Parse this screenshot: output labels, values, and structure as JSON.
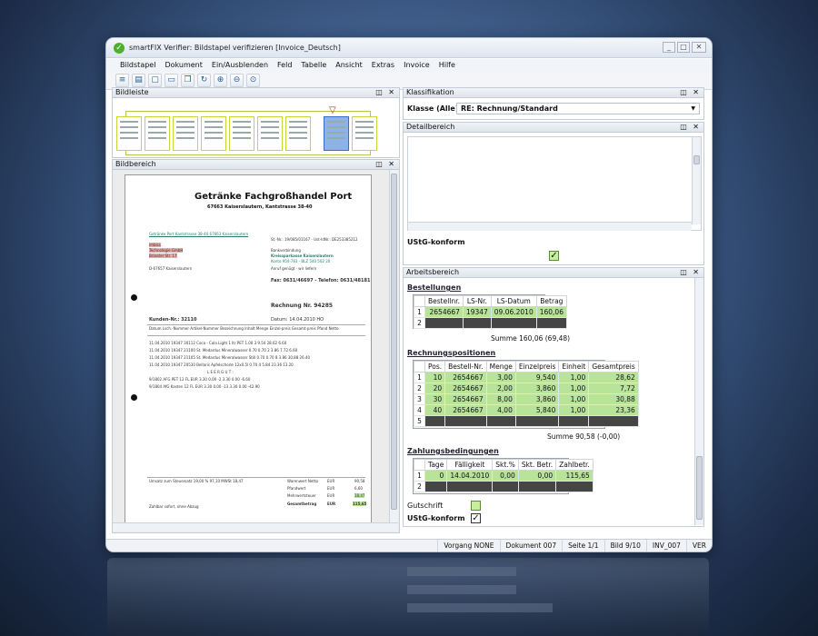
{
  "window": {
    "title": "smartFIX Verifier: Bildstapel verifizieren [Invoice_Deutsch]",
    "buttons": [
      "_",
      "□",
      "✕"
    ]
  },
  "menu": [
    "Bildstapel",
    "Dokument",
    "Ein/Ausblenden",
    "Feld",
    "Tabelle",
    "Ansicht",
    "Extras",
    "Invoice",
    "Hilfe"
  ],
  "panels": {
    "bildleiste": "Bildleiste",
    "bildbereich": "Bildbereich",
    "klassifikation": "Klassifikation",
    "detailbereich": "Detailbereich",
    "arbeitsbereich": "Arbeitsbereich"
  },
  "klassifikation": {
    "label": "Klasse (Alle):",
    "value": "RE: Rechnung/Standard"
  },
  "detail": {
    "ustg_label": "UStG-konform"
  },
  "document": {
    "title": "Getränke Fachgroßhandel Port",
    "address": "67663 Kaiserslautern, Kantstrasse 38-40",
    "sender_line": "Getränke Port  Kantstrasse 38-40  67663 Kaiserslautern",
    "recipient1": "imbiss",
    "recipient2": "Technologie GmbH",
    "recipient3": "Brassler Str. 17",
    "recipient4": "D-67657 Kaiserslautern",
    "steuer": "St.-Nr.: 19/085/01167 - Ust-IdNr.: DE253385212",
    "bank1": "Bankverbindung",
    "bank2": "Kreissparkasse Kaiserslautern",
    "bank3": "Konto 954-783 - BLZ 540 502 20",
    "anruf": "Anruf genügt - wir liefern",
    "fax": "Fax: 0631/46697  -  Telefon: 0631/48181",
    "rechnung": "Rechnung Nr. 94285",
    "kunden": "Kunden-Nr.: 32110",
    "datum": "Datum: 14.04.2010 HO",
    "col_header": "Datum    Lsch.-Nummer   Artikel-Nummer   Bezeichnung           Inhalt  Menge   Einzel-preis  Gesamt-preis  Pfand Netto",
    "rows": [
      "11.04.2010  19347   30112   Coca - Cola Light      1 ltr PET   1.00    3    9.54   28.62   6.60",
      "11.04.2010  19347   21100   St. Medardus Mineralwasser   0.70   0.70    2    3.86    7.72   6.60",
      "11.04.2010  19347   21105   St. Medardus Mineralwasser Still  0.70  0.70   8   3.86   30.88   26.40",
      "11.04.2010  19347   20530   Bellaris Apfelschorle   12x0.5l   0.70    4    5.84   23.36   13.20",
      "L E E R G U T :",
      "        9/1802   AFG PET   12 FL   EUR 3.30      0.00    -2    3.30    0.00    -6.60",
      "        9/1804   AfG Kasten   12 FL   EUR 3.30    0.00   -13    3.30    0.00   -42.90"
    ],
    "footer1": "Umsatz zum Steuersatz 19,00 %      97,10      MWSt      18,47",
    "footer_labels": [
      "Warenwert Netto",
      "Pfandwert",
      "Mehrwertsteuer",
      "Gesamtbetrag"
    ],
    "footer_cur": [
      "EUR",
      "EUR",
      "EUR",
      "EUR"
    ],
    "footer_vals": [
      "90,58",
      "6,60",
      "18,47",
      "115,65"
    ],
    "zahlbar": "Zahlbar sofort, ohne Abzug"
  },
  "bestellungen": {
    "title": "Bestellungen",
    "headers": [
      "",
      "Bestellnr.",
      "LS-Nr.",
      "LS-Datum",
      "Betrag"
    ],
    "rows": [
      {
        "idx": "1",
        "cells": [
          "2654667",
          "19347",
          "09.06.2010",
          "160,06"
        ]
      },
      {
        "idx": "2",
        "cells": [
          "",
          "",
          "",
          ""
        ]
      }
    ],
    "summe": "Summe 160,06 (69,48)"
  },
  "rechnungspositionen": {
    "title": "Rechnungspositionen",
    "headers": [
      "",
      "Pos.",
      "Bestell-Nr.",
      "Menge",
      "Einzelpreis",
      "Einheit",
      "Gesamtpreis"
    ],
    "rows": [
      {
        "idx": "1",
        "cells": [
          "10",
          "2654667",
          "3,00",
          "9,540",
          "1,00",
          "28,62"
        ]
      },
      {
        "idx": "2",
        "cells": [
          "20",
          "2654667",
          "2,00",
          "3,860",
          "1,00",
          "7,72"
        ]
      },
      {
        "idx": "3",
        "cells": [
          "30",
          "2654667",
          "8,00",
          "3,860",
          "1,00",
          "30,88"
        ]
      },
      {
        "idx": "4",
        "cells": [
          "40",
          "2654667",
          "4,00",
          "5,840",
          "1,00",
          "23,36"
        ]
      },
      {
        "idx": "5",
        "cells": [
          "",
          "",
          "",
          "",
          "",
          ""
        ]
      }
    ],
    "summe": "Summe 90,58 (-0,00)"
  },
  "zahlungsbedingungen": {
    "title": "Zahlungsbedingungen",
    "headers": [
      "",
      "Tage",
      "Fälligkeit",
      "Skt.%",
      "Skt. Betr.",
      "Zahlbetr."
    ],
    "rows": [
      {
        "idx": "1",
        "cells": [
          "0",
          "14.04.2010",
          "0,00",
          "0,00",
          "115,65"
        ]
      },
      {
        "idx": "2",
        "cells": [
          "",
          "",
          "",
          "",
          ""
        ]
      }
    ]
  },
  "gutschrift_label": "Gutschrift",
  "ustg_label2": "UStG-konform",
  "status": [
    "Vorgang NONE",
    "Dokument 007",
    "Seite 1/1",
    "Bild 9/10",
    "INV_007",
    "VER"
  ],
  "icons": {
    "app": "check-icon",
    "float": "float-icon",
    "close": "close-icon",
    "checkmark": "✓"
  }
}
